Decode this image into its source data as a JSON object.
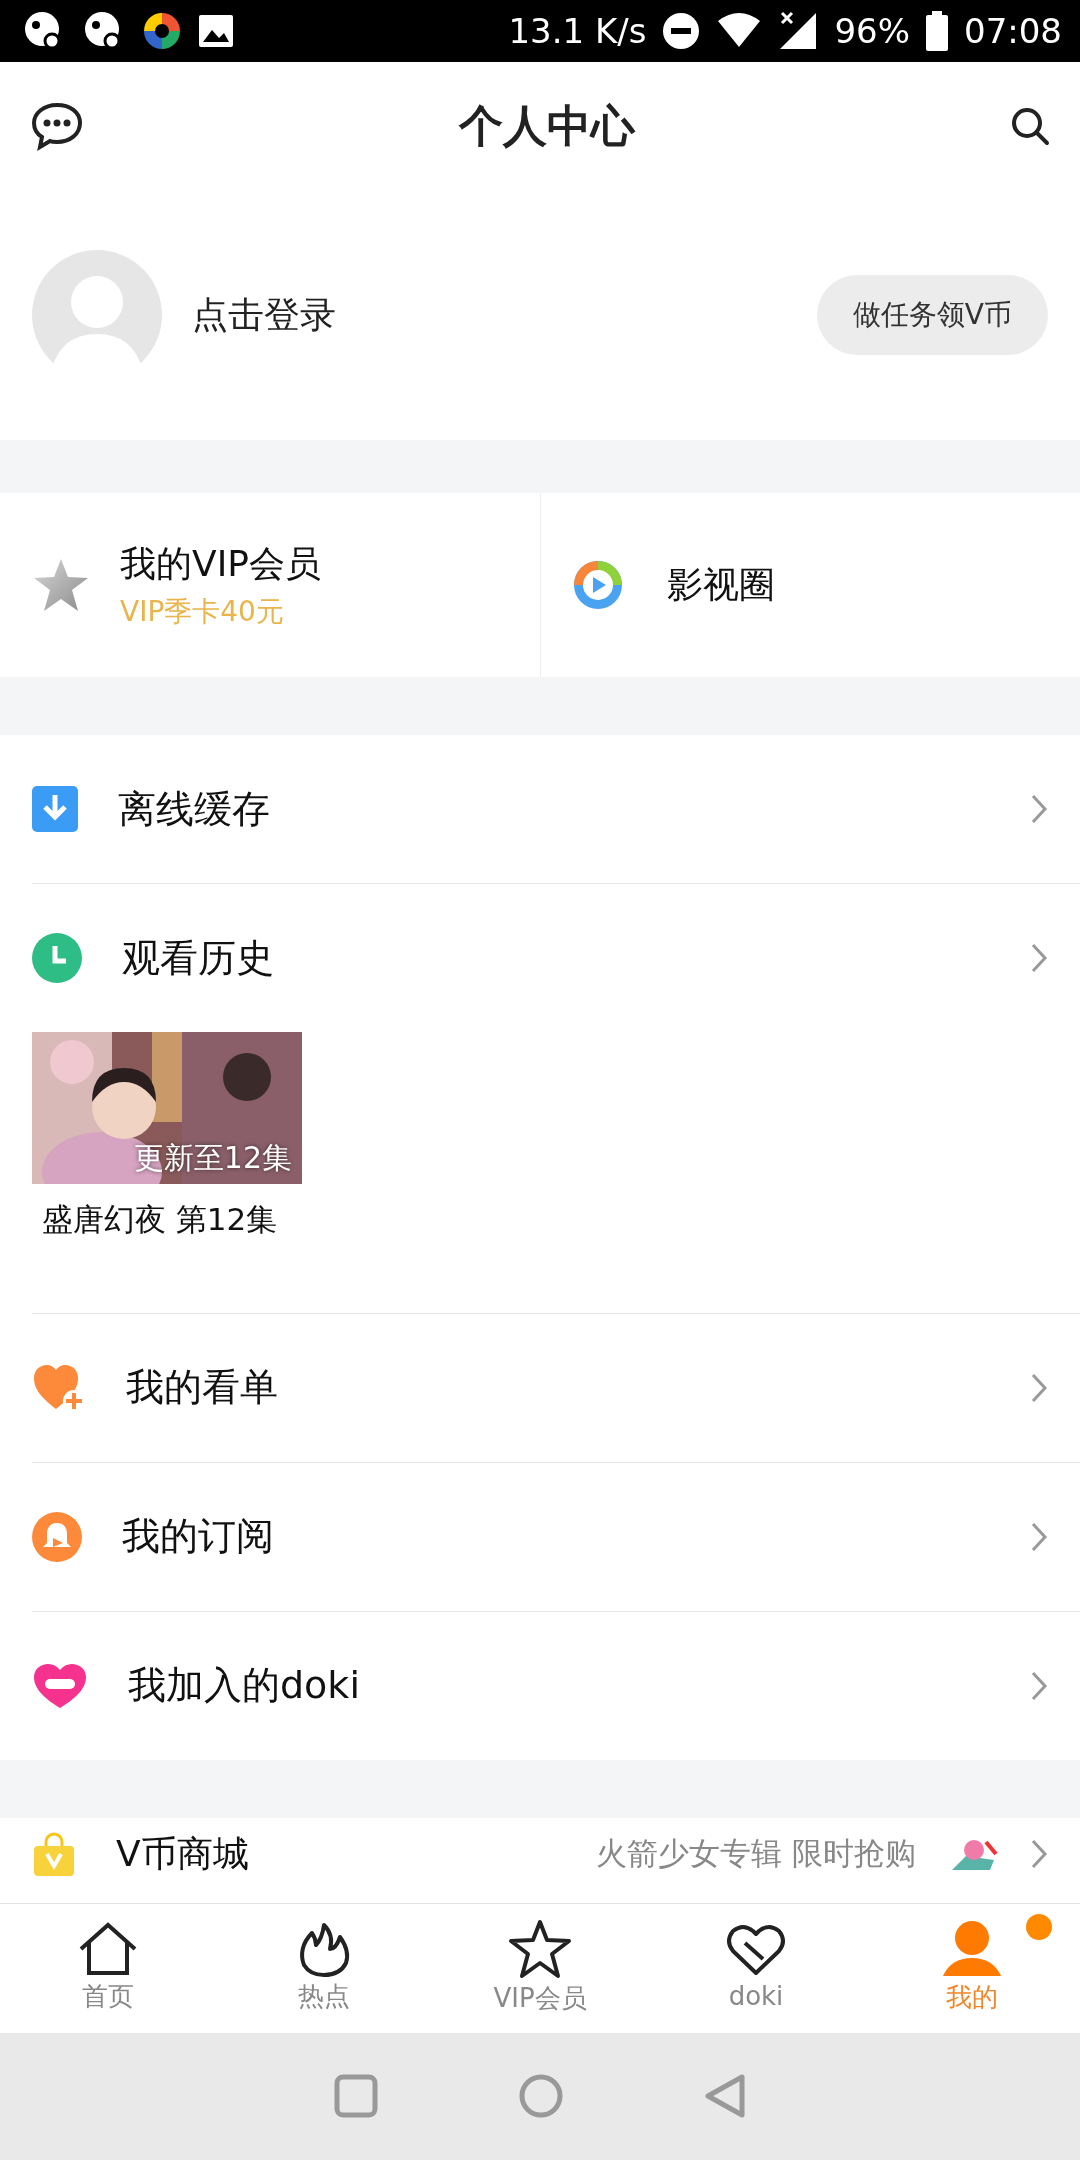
{
  "status_bar": {
    "network_speed": "13.1 K/s",
    "battery": "96%",
    "time": "07:08"
  },
  "header": {
    "title": "个人中心"
  },
  "profile": {
    "login_text": "点击登录",
    "task_button": "做任务领V币"
  },
  "quick_links": [
    {
      "kind": "vip",
      "title": "我的VIP会员",
      "subtitle": "VIP季卡40元"
    },
    {
      "kind": "circle",
      "title": "影视圈"
    }
  ],
  "menu_sections": [
    [
      {
        "kind": "download",
        "label": "离线缓存"
      },
      {
        "kind": "history",
        "label": "观看历史",
        "history": [
          {
            "kind": "picture",
            "badge": "更新至12集",
            "title": "盛唐幻夜 第12集"
          }
        ]
      },
      {
        "kind": "heart",
        "label": "我的看单"
      },
      {
        "kind": "bell",
        "label": "我的订阅"
      },
      {
        "kind": "doki",
        "label": "我加入的doki"
      }
    ]
  ],
  "shop": {
    "label": "V币商城",
    "promo": "火箭少女专辑 限时抢购"
  },
  "tabs": [
    {
      "kind": "home",
      "label": "首页",
      "selected": false,
      "badge": false
    },
    {
      "kind": "fire",
      "label": "热点",
      "selected": false,
      "badge": false
    },
    {
      "kind": "star",
      "label": "VIP会员",
      "selected": false,
      "badge": false
    },
    {
      "kind": "doki",
      "label": "doki",
      "selected": false,
      "badge": false
    },
    {
      "kind": "person",
      "label": "我的",
      "selected": true,
      "badge": true
    }
  ]
}
